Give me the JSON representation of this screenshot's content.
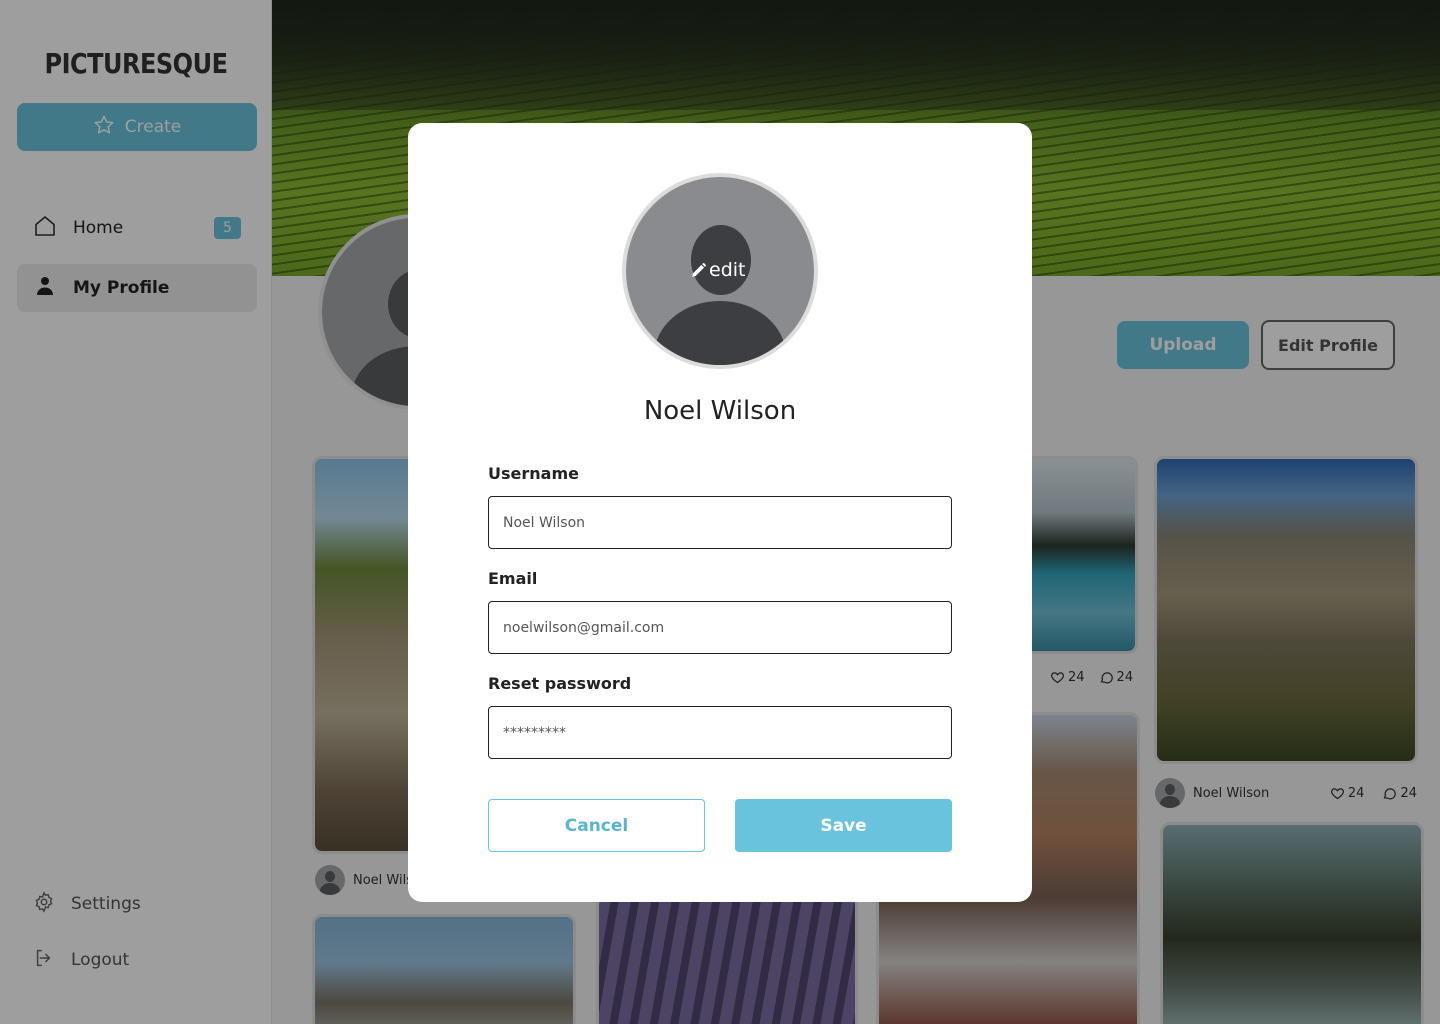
{
  "app": {
    "logo": "PICTURESQUE"
  },
  "sidebar": {
    "create_label": "Create",
    "items": [
      {
        "label": "Home",
        "badge": "5",
        "icon": "home-icon"
      },
      {
        "label": "My Profile",
        "icon": "user-icon",
        "active": true
      }
    ],
    "bottom": [
      {
        "label": "Settings",
        "icon": "gear-icon"
      },
      {
        "label": "Logout",
        "icon": "logout-icon"
      }
    ]
  },
  "profile": {
    "upload_label": "Upload",
    "edit_profile_label": "Edit Profile",
    "avatar_edit_label": "edit"
  },
  "gallery": {
    "cards": [
      {
        "author": "Noel Wilson",
        "likes": "24",
        "comments": "24"
      },
      {
        "author": "Noel Wilson",
        "likes": "24",
        "comments": "24"
      },
      {
        "author": "Noel Wilson",
        "likes": "24",
        "comments": "24"
      }
    ]
  },
  "modal": {
    "avatar_edit_label": "edit",
    "name": "Noel Wilson",
    "username_label": "Username",
    "username_value": "Noel Wilson",
    "email_label": "Email",
    "email_value": "noelwilson@gmail.com",
    "password_label": "Reset password",
    "password_value": "*********",
    "cancel_label": "Cancel",
    "save_label": "Save"
  },
  "colors": {
    "accent": "#6ac3dc",
    "overlay": "rgba(0,0,0,0.38)"
  }
}
